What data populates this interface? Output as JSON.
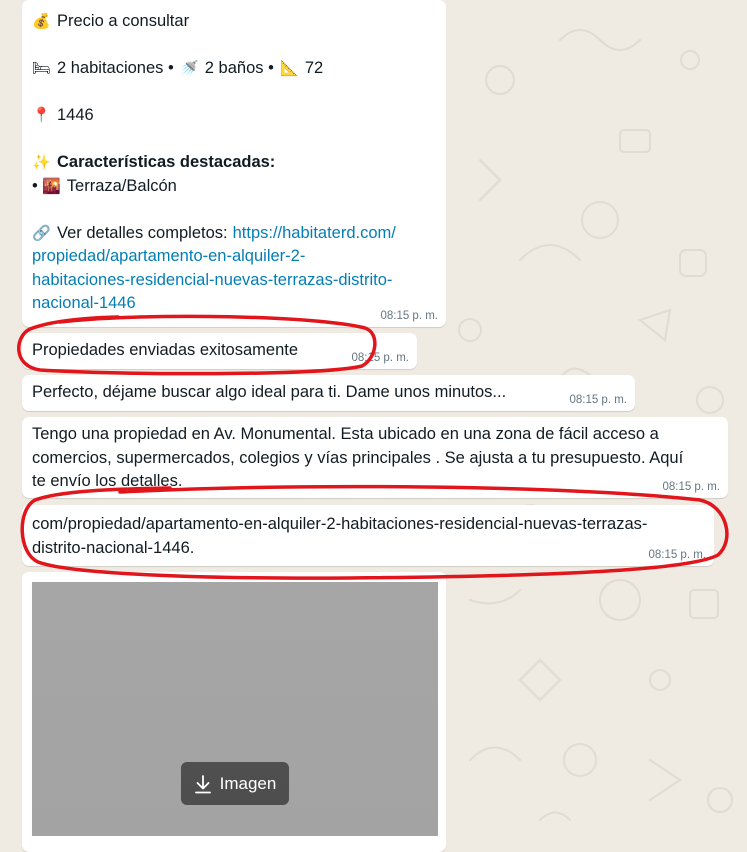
{
  "messages": {
    "listing": {
      "price_emoji": "💰",
      "price": "Precio a consultar",
      "specs_emoji_bed": "🛏",
      "rooms": "2 habitaciones •",
      "specs_emoji_bath": "🚿",
      "baths": "2 baños •",
      "specs_emoji_area": "📐",
      "area": "72",
      "pin_emoji": "📍",
      "ref": "1446",
      "features_emoji": "✨",
      "features_title": "Características destacadas:",
      "feature_bullet": "•",
      "feature_emoji": "🌇",
      "feature": "Terraza/Balcón",
      "link_emoji": "🔗",
      "details_label": "Ver detalles completos:",
      "url_lines": [
        "https://habitaterd.com/",
        "propiedad/apartamento-en-alquiler-2-",
        "habitaciones-residencial-nuevas-terrazas-distrito-",
        "nacional-1446"
      ],
      "time": "08:15 p. m."
    },
    "sent_confirmation": {
      "text": "Propiedades enviadas exitosamente",
      "time": "08:15 p. m."
    },
    "searching": {
      "text": "Perfecto, déjame buscar algo ideal para ti. Dame unos minutos...",
      "time": "08:15 p. m."
    },
    "property_info": {
      "lines": [
        "Tengo una propiedad en Av. Monumental. Esta ubicado en una zona de fácil acceso a",
        "comercios, supermercados, colegios y vías principales . Se ajusta a tu presupuesto. Aquí",
        "te envío los detalles."
      ],
      "time": "08:15 p. m."
    },
    "partial_url": {
      "lines": [
        "com/propiedad/apartamento-en-alquiler-2-habitaciones-residencial-nuevas-terrazas-",
        "distrito-nacional-1446."
      ],
      "time": "08:15 p. m."
    },
    "image": {
      "download_label": "Imagen"
    }
  },
  "colors": {
    "wallpaper": "#efeae2",
    "bubble": "#ffffff",
    "link": "#027eb5",
    "timestamp": "#667781",
    "annotation": "#e0161c"
  }
}
